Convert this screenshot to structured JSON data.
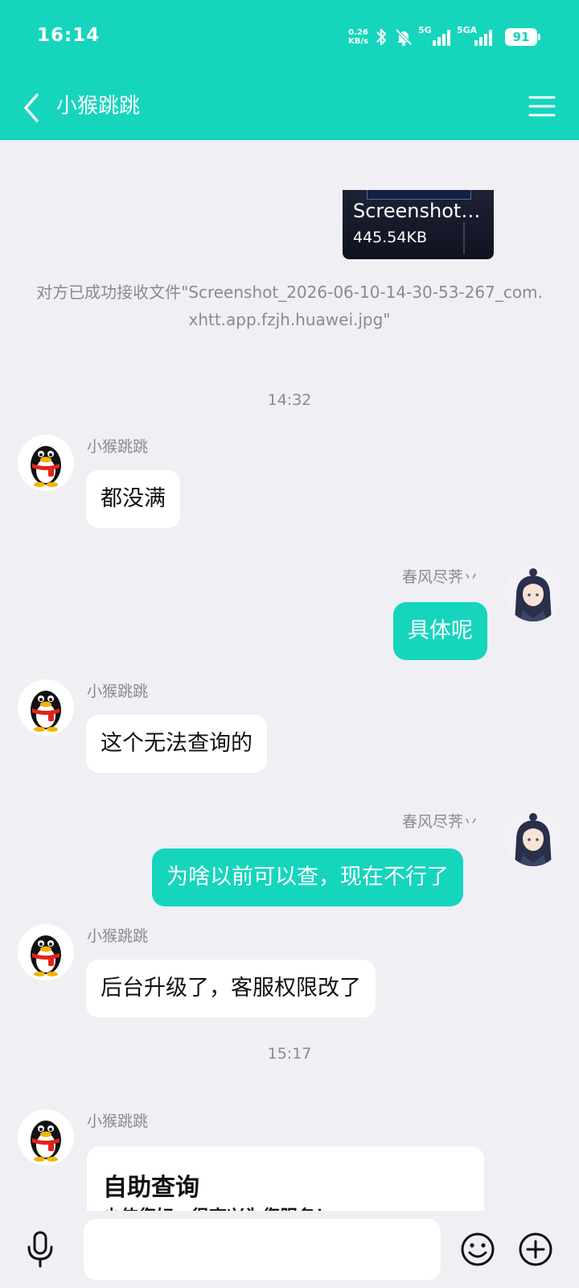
{
  "status_bar": {
    "time": "16:14",
    "net_speed_value": "0.26",
    "net_speed_unit": "KB/s",
    "signal1_label": "5G",
    "signal2_label": "5GA",
    "battery": "91"
  },
  "header": {
    "title": "小猴跳跳"
  },
  "file_message": {
    "file_name": "Screenshot…",
    "file_size": "445.54KB"
  },
  "system_notice": "对方已成功接收文件\"Screenshot_2026-06-10-14-30-53-267_com.xhtt.app.fzjh.huawei.jpg\"",
  "time_dividers": [
    "14:32",
    "15:17"
  ],
  "messages": [
    {
      "side": "left",
      "sender": "小猴跳跳",
      "text": "都没满"
    },
    {
      "side": "right",
      "sender": "春风尽荠丷",
      "text": "具体呢"
    },
    {
      "side": "left",
      "sender": "小猴跳跳",
      "text": "这个无法查询的"
    },
    {
      "side": "right",
      "sender": "春风尽荠丷",
      "text": "为啥以前可以查，现在不行了"
    },
    {
      "side": "left",
      "sender": "小猴跳跳",
      "text": "后台升级了，客服权限改了"
    },
    {
      "side": "left",
      "sender": "小猴跳跳",
      "text": ""
    }
  ],
  "card_message": {
    "title": "自助查询",
    "subtitle": "少侠您好，很高兴为您服务！"
  },
  "input_bar": {
    "text_value": ""
  },
  "colors": {
    "accent": "#16d5bd",
    "background": "#efeff4",
    "bubble_left": "#ffffff"
  },
  "icons": {
    "back": "chevron-left-icon",
    "menu": "hamburger-menu-icon",
    "mic": "microphone-icon",
    "emoji": "smiley-icon",
    "plus": "plus-circle-icon"
  }
}
